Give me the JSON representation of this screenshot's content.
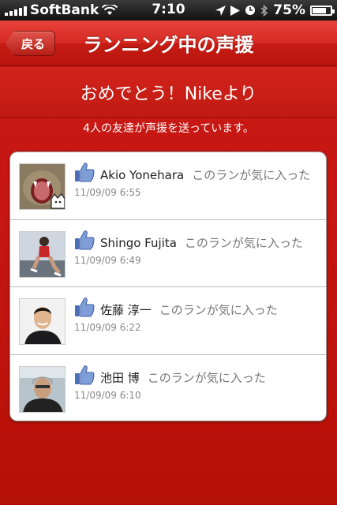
{
  "status_bar": {
    "carrier": "SoftBank",
    "time": "7:10",
    "battery": "75",
    "battery_unit": "%",
    "battery_level": 0.75
  },
  "nav": {
    "back_label": "戻る",
    "title": "ランニング中の声援"
  },
  "banner": {
    "text": "おめでとう！Nikeより"
  },
  "subtitle": "4人の友達が声援を送っています。",
  "cheers": [
    {
      "name": "Akio Yonehara",
      "message": "このランが気に入った",
      "time": "11/09/09  6:55"
    },
    {
      "name": "Shingo Fujita",
      "message": "このランが気に入った",
      "time": "11/09/09  6:49"
    },
    {
      "name": "佐藤 淳一",
      "message": "このランが気に入った",
      "time": "11/09/09  6:22"
    },
    {
      "name": "池田 博",
      "message": "このランが気に入った",
      "time": "11/09/09  6:10"
    }
  ],
  "colors": {
    "nav_red": "#d42a22",
    "like_blue": "#5b7bc0"
  }
}
